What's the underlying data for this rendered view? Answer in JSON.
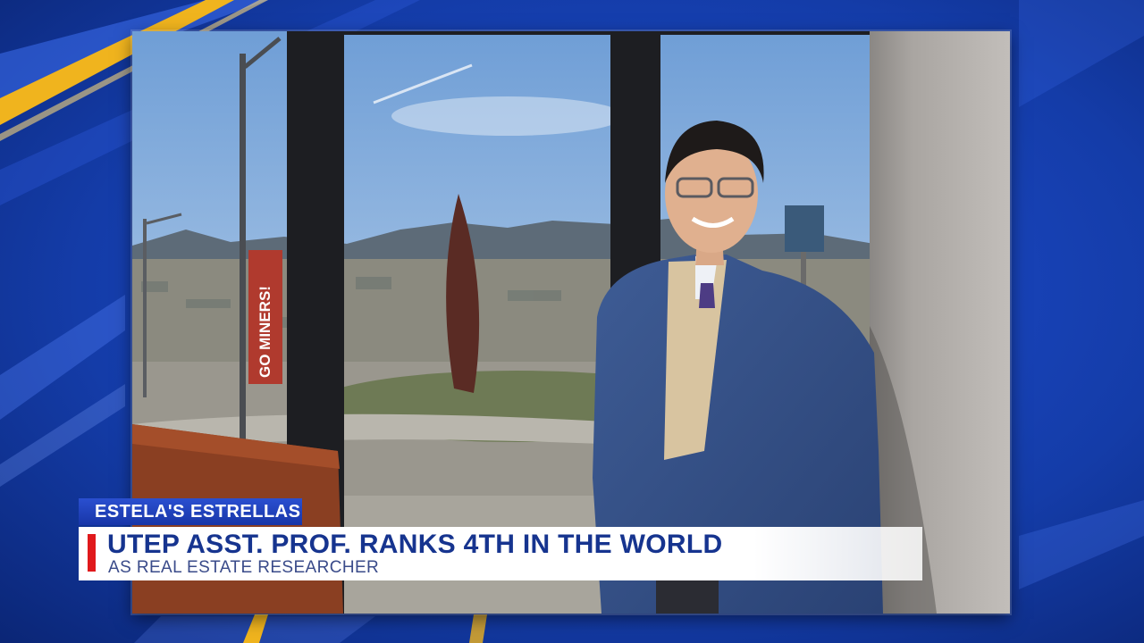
{
  "lower_third": {
    "show_name": "ESTELA'S ESTRELLAS",
    "headline": "UTEP ASST. PROF. RANKS 4TH IN THE WORLD",
    "subheadline": "AS REAL ESTATE RESEARCHER",
    "accent_color": "#e0191c",
    "headline_color": "#16348f"
  },
  "photo": {
    "banner_text": "GO MINERS!",
    "banner_color": "#b03a2e"
  },
  "backdrop": {
    "base_color": "#0d2f8c",
    "stripe_color": "#f0b41e"
  }
}
